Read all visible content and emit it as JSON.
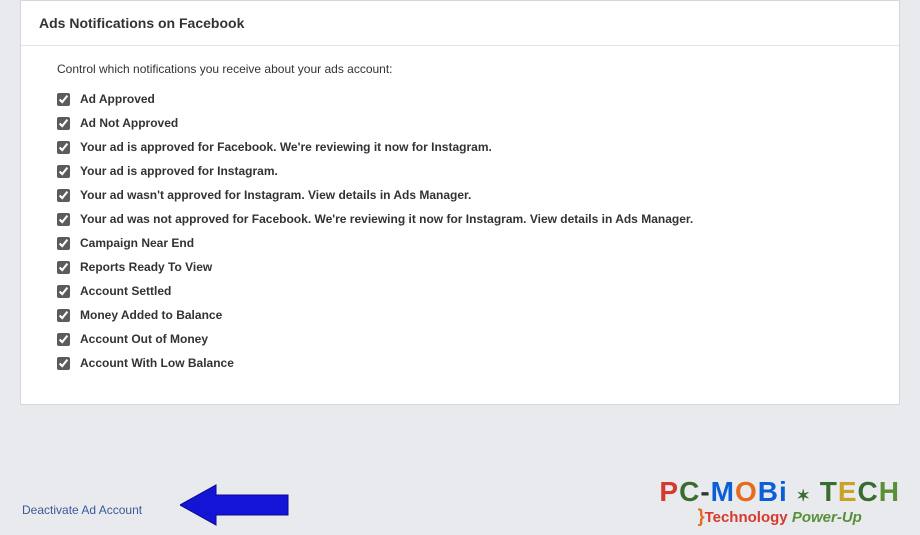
{
  "panel": {
    "title": "Ads Notifications on Facebook",
    "intro": "Control which notifications you receive about your ads account:"
  },
  "notifications": [
    {
      "label": "Ad Approved",
      "checked": true
    },
    {
      "label": "Ad Not Approved",
      "checked": true
    },
    {
      "label": "Your ad is approved for Facebook. We're reviewing it now for Instagram.",
      "checked": true
    },
    {
      "label": "Your ad is approved for Instagram.",
      "checked": true
    },
    {
      "label": "Your ad wasn't approved for Instagram. View details in Ads Manager.",
      "checked": true
    },
    {
      "label": "Your ad was not approved for Facebook. We're reviewing it now for Instagram. View details in Ads Manager.",
      "checked": true
    },
    {
      "label": "Campaign Near End",
      "checked": true
    },
    {
      "label": "Reports Ready To View",
      "checked": true
    },
    {
      "label": "Account Settled",
      "checked": true
    },
    {
      "label": "Money Added to Balance",
      "checked": true
    },
    {
      "label": "Account Out of Money",
      "checked": true
    },
    {
      "label": "Account With Low Balance",
      "checked": true
    }
  ],
  "deactivate": {
    "label": "Deactivate Ad Account"
  },
  "watermark": {
    "line1": "PC-MOBi TECH",
    "line2_prefix": "}Technology ",
    "line2_suffix": "Power-Up"
  },
  "colors": {
    "arrow": "#1414d6",
    "link": "#3b5998",
    "page_bg": "#e9eaed"
  }
}
